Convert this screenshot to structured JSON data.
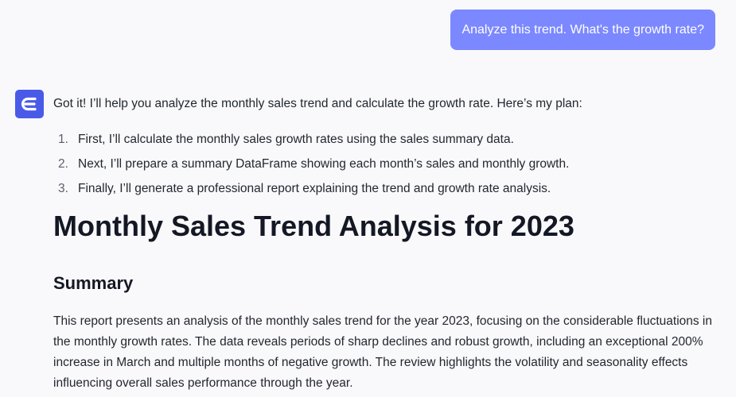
{
  "conversation": {
    "user_message": "Analyze this trend. What's the growth rate?",
    "assistant": {
      "avatar_icon": "e-logo-icon",
      "avatar_color": "#4a5ae8",
      "intro": "Got it! I’ll help you analyze the monthly sales trend and calculate the growth rate. Here’s my plan:",
      "plan": [
        {
          "num": "1.",
          "text": "First, I’ll calculate the monthly sales growth rates using the sales summary data."
        },
        {
          "num": "2.",
          "text": "Next, I’ll prepare a summary DataFrame showing each month’s sales and monthly growth."
        },
        {
          "num": "3.",
          "text": "Finally, I’ll generate a professional report explaining the trend and growth rate analysis."
        }
      ],
      "report": {
        "title": "Monthly Sales Trend Analysis for 2023",
        "summary_heading": "Summary",
        "summary_text": "This report presents an analysis of the monthly sales trend for the year 2023, focusing on the considerable fluctuations in the monthly growth rates. The data reveals periods of sharp declines and robust growth, including an exceptional 200% increase in March and multiple months of negative growth. The review highlights the volatility and seasonality effects influencing overall sales performance through the year."
      }
    }
  },
  "colors": {
    "background": "#f9f9fb",
    "user_bubble": "#7b88ff",
    "user_text": "#ffffff",
    "heading_text": "#141824",
    "body_text": "#23272f"
  }
}
